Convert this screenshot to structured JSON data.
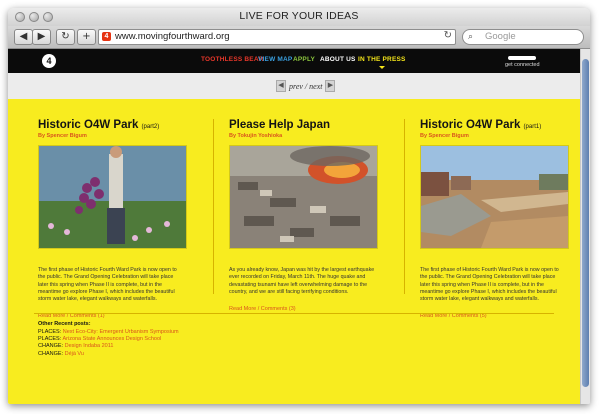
{
  "window": {
    "title": "LIVE FOR YOUR IDEAS"
  },
  "browser": {
    "url": "www.movingfourthward.org",
    "favicon": "4",
    "search_placeholder": "Google",
    "back_icon": "back-arrow",
    "forward_icon": "forward-arrow",
    "reload_icon": "refresh",
    "add_icon": "plus",
    "search_icon": "magnifier"
  },
  "site": {
    "logo": "4",
    "nav": [
      {
        "label": "TOOTHLESS BEAR",
        "color": "#e8372a"
      },
      {
        "label": "VIEW MAP",
        "color": "#3aa0e0"
      },
      {
        "label": "APPLY",
        "color": "#8cc63f"
      },
      {
        "label": "ABOUT US",
        "color": "#ffffff"
      },
      {
        "label": "IN THE PRESS",
        "color": "#f5e61a",
        "active": true
      }
    ],
    "connect_label": "get connected",
    "pager": {
      "prev_next": "prev / next"
    },
    "colors": {
      "background": "#f8ec1f",
      "accent": "#d9551d",
      "nav_bg": "#0b0b0b"
    }
  },
  "posts": [
    {
      "title": "Historic O4W Park",
      "part": "(part2)",
      "byline": "By Spencer Bigum",
      "excerpt": "The first phase of Historic Fourth Ward Park is now open to the public. The Grand Opening Celebration will take place later this spring when Phase II is complete, but in the meantime go explore Phase I, which includes the beautiful storm water lake, elegant walkways and waterfalls.",
      "links": "Read More / Comments (1)"
    },
    {
      "title": "Please Help Japan",
      "part": "",
      "byline": "By Tokujin Yoshioka",
      "excerpt": "As you already know, Japan was hit by the largest earthquake ever recorded on Friday, March 11th. The huge quake and devastating tsunami have left overwhelming damage to the country, and we are still facing terrifying conditions.",
      "links": "Read More / Comments (3)"
    },
    {
      "title": "Historic O4W Park",
      "part": "(part1)",
      "byline": "By Spencer Bigum",
      "excerpt": "The first phase of Historic Fourth Ward Park is now open to the public. The Grand Opening Celebration will take place later this spring when Phase II is complete, but in the meantime go explore Phase I, which includes the beautiful storm water lake, elegant walkways and waterfalls.",
      "links": "Read More / Comments (5)"
    }
  ],
  "recent": {
    "heading": "Other Recent posts:",
    "items": [
      {
        "category": "PLACES:",
        "title": "Next Eco-City: Emergent Urbanism Symposium"
      },
      {
        "category": "PLACES:",
        "title": "Arizona State Announces Design School"
      },
      {
        "category": "CHANGE:",
        "title": "Design Indaba 2011"
      },
      {
        "category": "CHANGE:",
        "title": "Déjà Vu"
      }
    ]
  }
}
